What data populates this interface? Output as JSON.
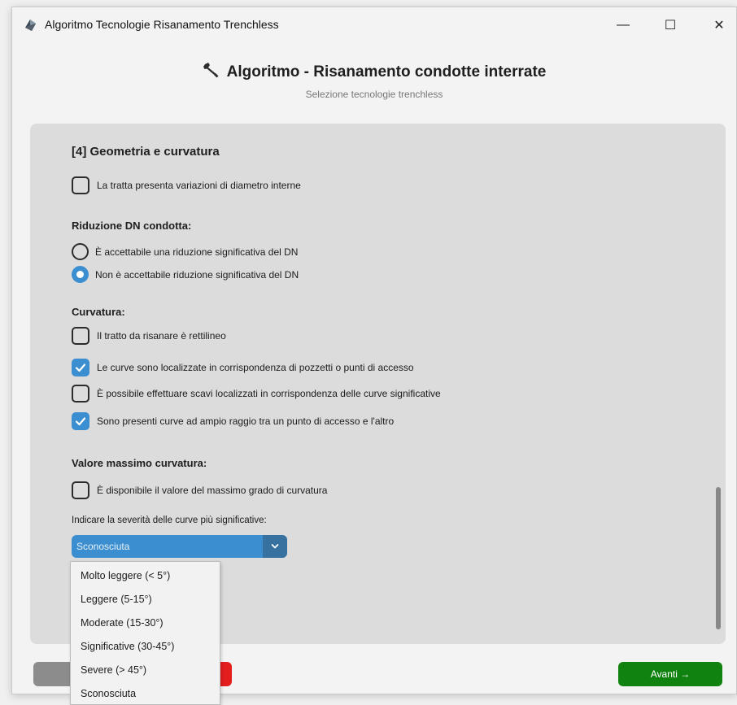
{
  "window": {
    "title": "Algoritmo Tecnologie Risanamento Trenchless",
    "controls": {
      "minimize": "—",
      "maximize": "☐",
      "close": "✕"
    }
  },
  "header": {
    "title": "Algoritmo - Risanamento condotte interrate",
    "subtitle": "Selezione tecnologie trenchless"
  },
  "section": {
    "title": "[4] Geometria e curvatura",
    "diameter_variation": {
      "label": "La tratta presenta variazioni di diametro interne",
      "checked": false
    },
    "dn_reduction": {
      "title": "Riduzione DN condotta:",
      "options": [
        {
          "label": "È accettabile una riduzione significativa del DN",
          "selected": false
        },
        {
          "label": "Non è accettabile riduzione significativa del DN",
          "selected": true
        }
      ]
    },
    "curvature": {
      "title": "Curvatura:",
      "items": [
        {
          "label": "Il tratto da risanare è rettilineo",
          "checked": false
        },
        {
          "label": "Le curve sono localizzate in corrispondenza di pozzetti o punti di accesso",
          "checked": true
        },
        {
          "label": "È possibile effettuare scavi localizzati in corrispondenza delle curve significative",
          "checked": false
        },
        {
          "label": "Sono presenti curve ad ampio raggio tra un punto di accesso e l'altro",
          "checked": true
        }
      ]
    },
    "max_curvature": {
      "title": "Valore massimo curvatura:",
      "available": {
        "label": "È disponibile il valore del massimo grado di curvatura",
        "checked": false
      },
      "severity_label": "Indicare la severità delle curve più significative:",
      "selected": "Sconosciuta",
      "options": [
        "Molto leggere (< 5°)",
        "Leggere (5-15°)",
        "Moderate (15-30°)",
        "Significative (30-45°)",
        "Severe (> 45°)",
        "Sconosciuta"
      ]
    }
  },
  "footer": {
    "back_label": "←",
    "next_label": "Avanti →"
  },
  "colors": {
    "accent": "#3b8ed0",
    "accent_dark": "#36719f",
    "next": "#0f820f",
    "danger": "#e41d1d",
    "back": "#8c8c8c",
    "panel": "#dcdcdc"
  },
  "icons": {
    "app": "app-logo-icon",
    "header": "wrench-icon",
    "check": "check-icon",
    "chevron": "chevron-down-icon"
  }
}
